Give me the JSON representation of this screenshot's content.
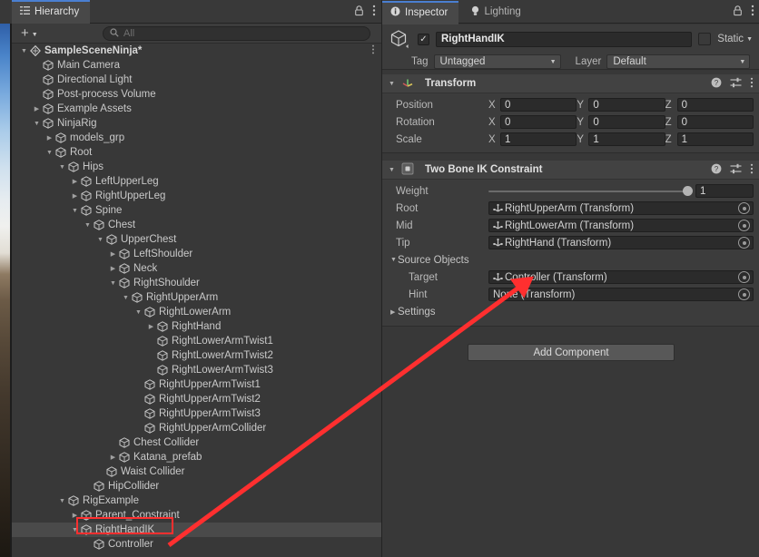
{
  "hierarchy": {
    "tab_label": "Hierarchy",
    "tab_icon": "hierarchy-icon",
    "lock_icon": "lock-icon",
    "menu_icon": "kebab-menu-icon",
    "create_label": "+",
    "search": {
      "placeholder": "All",
      "value": "",
      "icon": "search-icon"
    },
    "rows": [
      {
        "label": "SampleSceneNinja*",
        "depth": 1,
        "fold": "down",
        "type": "scene",
        "selected": false,
        "kebab": true
      },
      {
        "label": "Main Camera",
        "depth": 2,
        "fold": "none",
        "type": "go",
        "selected": false
      },
      {
        "label": "Directional Light",
        "depth": 2,
        "fold": "none",
        "type": "go",
        "selected": false
      },
      {
        "label": "Post-process Volume",
        "depth": 2,
        "fold": "none",
        "type": "go",
        "selected": false
      },
      {
        "label": "Example Assets",
        "depth": 2,
        "fold": "right",
        "type": "go",
        "selected": false
      },
      {
        "label": "NinjaRig",
        "depth": 2,
        "fold": "down",
        "type": "go",
        "selected": false
      },
      {
        "label": "models_grp",
        "depth": 3,
        "fold": "right",
        "type": "go",
        "selected": false
      },
      {
        "label": "Root",
        "depth": 3,
        "fold": "down",
        "type": "go",
        "selected": false
      },
      {
        "label": "Hips",
        "depth": 4,
        "fold": "down",
        "type": "go",
        "selected": false
      },
      {
        "label": "LeftUpperLeg",
        "depth": 5,
        "fold": "right",
        "type": "go",
        "selected": false
      },
      {
        "label": "RightUpperLeg",
        "depth": 5,
        "fold": "right",
        "type": "go",
        "selected": false
      },
      {
        "label": "Spine",
        "depth": 5,
        "fold": "down",
        "type": "go",
        "selected": false
      },
      {
        "label": "Chest",
        "depth": 6,
        "fold": "down",
        "type": "go",
        "selected": false
      },
      {
        "label": "UpperChest",
        "depth": 7,
        "fold": "down",
        "type": "go",
        "selected": false
      },
      {
        "label": "LeftShoulder",
        "depth": 8,
        "fold": "right",
        "type": "go",
        "selected": false
      },
      {
        "label": "Neck",
        "depth": 8,
        "fold": "right",
        "type": "go",
        "selected": false
      },
      {
        "label": "RightShoulder",
        "depth": 8,
        "fold": "down",
        "type": "go",
        "selected": false
      },
      {
        "label": "RightUpperArm",
        "depth": 9,
        "fold": "down",
        "type": "go",
        "selected": false
      },
      {
        "label": "RightLowerArm",
        "depth": 10,
        "fold": "down",
        "type": "go",
        "selected": false
      },
      {
        "label": "RightHand",
        "depth": 11,
        "fold": "right",
        "type": "go",
        "selected": false
      },
      {
        "label": "RightLowerArmTwist1",
        "depth": 11,
        "fold": "none",
        "type": "go",
        "selected": false
      },
      {
        "label": "RightLowerArmTwist2",
        "depth": 11,
        "fold": "none",
        "type": "go",
        "selected": false
      },
      {
        "label": "RightLowerArmTwist3",
        "depth": 11,
        "fold": "none",
        "type": "go",
        "selected": false
      },
      {
        "label": "RightUpperArmTwist1",
        "depth": 10,
        "fold": "none",
        "type": "go",
        "selected": false
      },
      {
        "label": "RightUpperArmTwist2",
        "depth": 10,
        "fold": "none",
        "type": "go",
        "selected": false
      },
      {
        "label": "RightUpperArmTwist3",
        "depth": 10,
        "fold": "none",
        "type": "go",
        "selected": false
      },
      {
        "label": "RightUpperArmCollider",
        "depth": 10,
        "fold": "none",
        "type": "go",
        "selected": false
      },
      {
        "label": "Chest Collider",
        "depth": 8,
        "fold": "none",
        "type": "go",
        "selected": false
      },
      {
        "label": "Katana_prefab",
        "depth": 8,
        "fold": "right",
        "type": "go",
        "selected": false
      },
      {
        "label": "Waist Collider",
        "depth": 7,
        "fold": "none",
        "type": "go",
        "selected": false
      },
      {
        "label": "HipCollider",
        "depth": 6,
        "fold": "none",
        "type": "go",
        "selected": false
      },
      {
        "label": "RigExample",
        "depth": 4,
        "fold": "down",
        "type": "go",
        "selected": false
      },
      {
        "label": "Parent_Constraint",
        "depth": 5,
        "fold": "right",
        "type": "go",
        "selected": false
      },
      {
        "label": "RightHandIK",
        "depth": 5,
        "fold": "down",
        "type": "go",
        "selected": true
      },
      {
        "label": "Controller",
        "depth": 6,
        "fold": "none",
        "type": "go",
        "selected": false
      }
    ]
  },
  "inspector": {
    "tabs": [
      {
        "label": "Inspector",
        "icon": "info-icon",
        "active": true
      },
      {
        "label": "Lighting",
        "icon": "light-bulb-icon",
        "active": false
      }
    ],
    "lock_icon": "lock-icon",
    "menu_icon": "kebab-menu-icon",
    "header": {
      "game_object_icon": "game-object-cube-icon",
      "enabled": true,
      "enabled_check": "✓",
      "name": "RightHandIK",
      "static_label": "Static",
      "static_checked": false,
      "tag_label": "Tag",
      "tag_value": "Untagged",
      "layer_label": "Layer",
      "layer_value": "Default"
    },
    "components": [
      {
        "title": "Transform",
        "icon": "transform-axes-icon",
        "expanded": true,
        "help_icon": "help-icon",
        "preset_icon": "preset-sliders-icon",
        "menu_icon": "kebab-menu-icon",
        "rows": [
          {
            "label": "Position",
            "x": "0",
            "y": "0",
            "z": "0"
          },
          {
            "label": "Rotation",
            "x": "0",
            "y": "0",
            "z": "0"
          },
          {
            "label": "Scale",
            "x": "1",
            "y": "1",
            "z": "1"
          }
        ],
        "axis_labels": {
          "x": "X",
          "y": "Y",
          "z": "Z"
        }
      },
      {
        "title": "Two Bone IK Constraint",
        "icon": "constraint-icon",
        "expanded": true,
        "help_icon": "help-icon",
        "preset_icon": "preset-sliders-icon",
        "menu_icon": "kebab-menu-icon",
        "weight": {
          "label": "Weight",
          "value": "1",
          "fraction": 1
        },
        "bones": [
          {
            "label": "Root",
            "value": "RightUpperArm (Transform)",
            "has_ref": true
          },
          {
            "label": "Mid",
            "value": "RightLowerArm (Transform)",
            "has_ref": true
          },
          {
            "label": "Tip",
            "value": "RightHand (Transform)",
            "has_ref": true
          }
        ],
        "source_objects": {
          "label": "Source Objects",
          "expanded": true,
          "fields": [
            {
              "label": "Target",
              "value": "Controller (Transform)",
              "has_ref": true
            },
            {
              "label": "Hint",
              "value": "None (Transform)",
              "has_ref": false
            }
          ]
        },
        "settings": {
          "label": "Settings",
          "expanded": false
        }
      }
    ],
    "add_component_label": "Add Component"
  },
  "annotation": {
    "color": "#ff2f2f",
    "highlight_target": "RightHandIK",
    "arrow_from": "RightHandIK hierarchy row",
    "arrow_to": "Target object field"
  }
}
